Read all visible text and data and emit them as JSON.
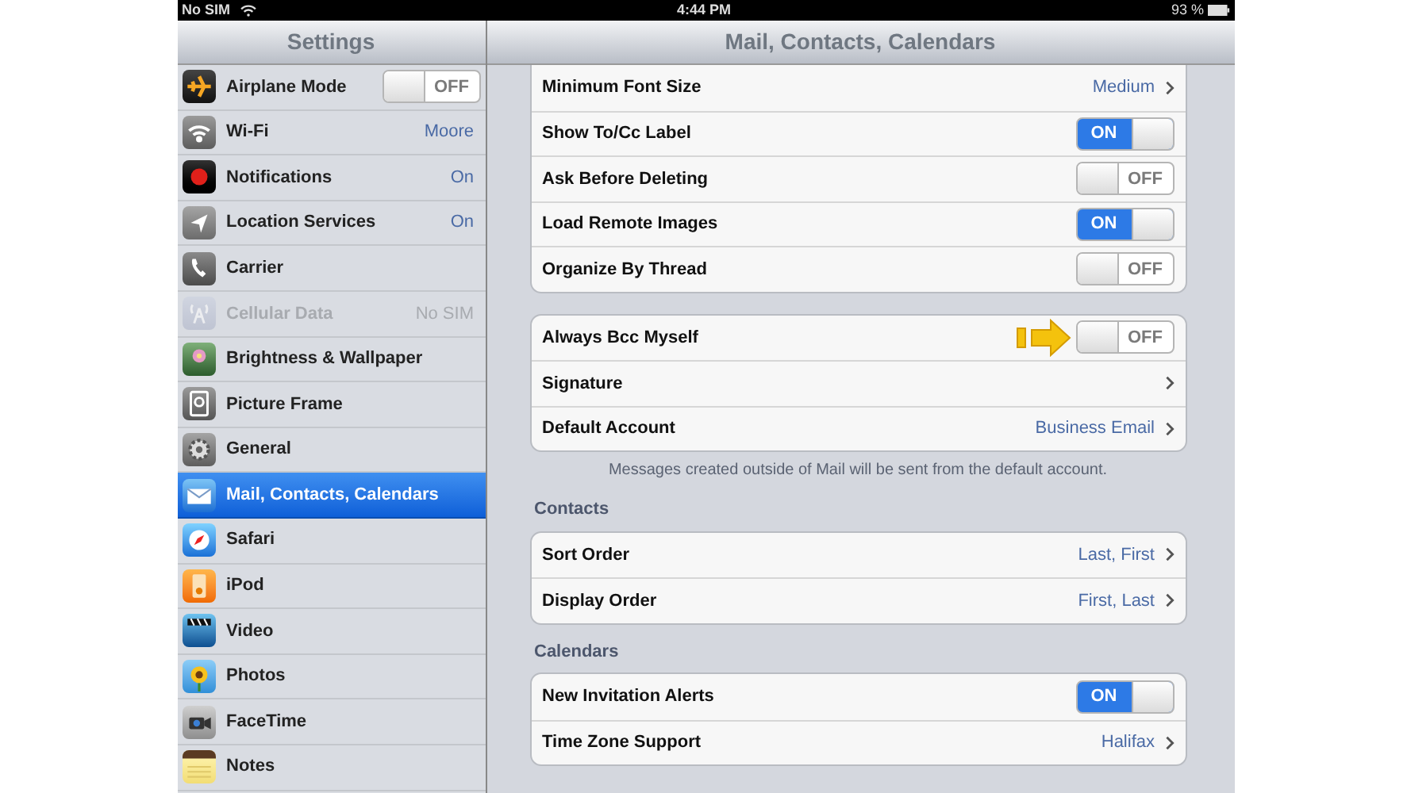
{
  "status_bar": {
    "carrier": "No SIM",
    "time": "4:44 PM",
    "battery": "93 %"
  },
  "sidebar": {
    "title": "Settings",
    "items": [
      {
        "kind": "toggle",
        "label": "Airplane Mode",
        "toggle": {
          "on": false,
          "label": "OFF"
        },
        "selected": false,
        "disabled": false
      },
      {
        "kind": "value",
        "label": "Wi-Fi",
        "value": "Moore",
        "selected": false,
        "disabled": false
      },
      {
        "kind": "value",
        "label": "Notifications",
        "value": "On",
        "selected": false,
        "disabled": false
      },
      {
        "kind": "value",
        "label": "Location Services",
        "value": "On",
        "selected": false,
        "disabled": false
      },
      {
        "kind": "plain",
        "label": "Carrier",
        "selected": false,
        "disabled": false
      },
      {
        "kind": "value",
        "label": "Cellular Data",
        "value": "No SIM",
        "selected": false,
        "disabled": true
      },
      {
        "kind": "plain",
        "label": "Brightness & Wallpaper",
        "selected": false,
        "disabled": false
      },
      {
        "kind": "plain",
        "label": "Picture Frame",
        "selected": false,
        "disabled": false
      },
      {
        "kind": "plain",
        "label": "General",
        "selected": false,
        "disabled": false
      },
      {
        "kind": "plain",
        "label": "Mail, Contacts, Calendars",
        "selected": true,
        "disabled": false
      },
      {
        "kind": "plain",
        "label": "Safari",
        "selected": false,
        "disabled": false
      },
      {
        "kind": "plain",
        "label": "iPod",
        "selected": false,
        "disabled": false
      },
      {
        "kind": "plain",
        "label": "Video",
        "selected": false,
        "disabled": false
      },
      {
        "kind": "plain",
        "label": "Photos",
        "selected": false,
        "disabled": false
      },
      {
        "kind": "plain",
        "label": "FaceTime",
        "selected": false,
        "disabled": false
      },
      {
        "kind": "plain",
        "label": "Notes",
        "selected": false,
        "disabled": false
      }
    ]
  },
  "detail": {
    "title": "Mail, Contacts, Calendars",
    "groups": [
      {
        "rows": [
          {
            "kind": "link",
            "label": "Minimum Font Size",
            "value": "Medium"
          },
          {
            "kind": "toggle",
            "label": "Show To/Cc Label",
            "toggle": {
              "on": true,
              "label": "ON"
            }
          },
          {
            "kind": "toggle",
            "label": "Ask Before Deleting",
            "toggle": {
              "on": false,
              "label": "OFF"
            }
          },
          {
            "kind": "toggle",
            "label": "Load Remote Images",
            "toggle": {
              "on": true,
              "label": "ON"
            }
          },
          {
            "kind": "toggle",
            "label": "Organize By Thread",
            "toggle": {
              "on": false,
              "label": "OFF"
            }
          }
        ]
      },
      {
        "rows": [
          {
            "kind": "toggle",
            "label": "Always Bcc Myself",
            "toggle": {
              "on": false,
              "label": "OFF"
            },
            "highlighted": true
          },
          {
            "kind": "link",
            "label": "Signature"
          },
          {
            "kind": "link",
            "label": "Default Account",
            "value": "Business Email"
          }
        ],
        "footer": "Messages created outside of Mail will be sent from the default account."
      },
      {
        "header": "Contacts",
        "rows": [
          {
            "kind": "link",
            "label": "Sort Order",
            "value": "Last, First"
          },
          {
            "kind": "link",
            "label": "Display Order",
            "value": "First, Last"
          }
        ]
      },
      {
        "header": "Calendars",
        "rows": [
          {
            "kind": "toggle",
            "label": "New Invitation Alerts",
            "toggle": {
              "on": true,
              "label": "ON"
            }
          },
          {
            "kind": "link",
            "label": "Time Zone Support",
            "value": "Halifax"
          }
        ]
      }
    ]
  }
}
